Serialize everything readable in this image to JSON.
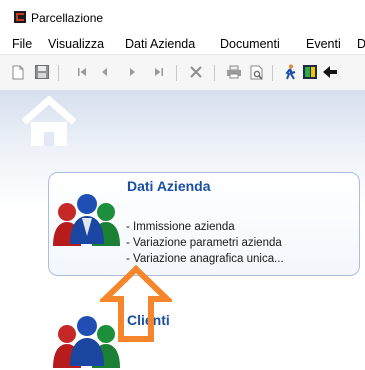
{
  "window": {
    "title": "Parcellazione",
    "app_icon": "app-logo-icon"
  },
  "menu": {
    "items": [
      {
        "label": "File"
      },
      {
        "label": "Visualizza"
      },
      {
        "label": "Dati Azienda"
      },
      {
        "label": "Documenti"
      },
      {
        "label": "Eventi"
      },
      {
        "label": "D"
      }
    ]
  },
  "toolbar": {
    "buttons": [
      "new-document-icon",
      "save-icon",
      "first-record-icon",
      "previous-record-icon",
      "next-record-icon",
      "last-record-icon",
      "delete-icon",
      "print-icon",
      "print-preview-icon",
      "run-icon",
      "exit-door-icon",
      "back-arrow-icon"
    ]
  },
  "home": {
    "icon": "home-icon"
  },
  "cards": {
    "dati_azienda": {
      "title": "Dati Azienda",
      "items": [
        "- Immissione azienda",
        "- Variazione parametri azienda",
        "- Variazione anagrafica unica..."
      ],
      "icon": "people-group-icon"
    },
    "clienti": {
      "title": "Clienti",
      "icon": "people-group-icon"
    }
  },
  "annotation": {
    "icon": "orange-up-arrow-icon",
    "color": "#f5862c"
  },
  "colors": {
    "card_title": "#1b4fa3",
    "card_border": "#a9bedf"
  }
}
